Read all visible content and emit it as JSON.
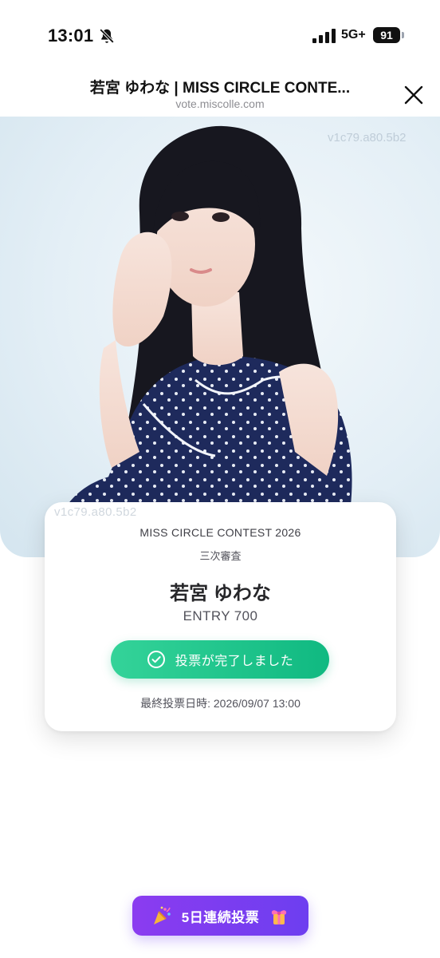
{
  "status_bar": {
    "time": "13:01",
    "network": "5G+",
    "battery": "91"
  },
  "header": {
    "title": "若宮 ゆわな | MISS CIRCLE CONTE...",
    "url": "vote.miscolle.com",
    "close_icon": "close-icon"
  },
  "watermark": "v1c79.a80.5b2",
  "card": {
    "contest": "MISS CIRCLE CONTEST 2026",
    "stage": "三次審査",
    "name": "若宮 ゆわな",
    "entry": "ENTRY 700",
    "vote_status": "投票が完了しました",
    "deadline": "最終投票日時: 2026/09/07 13:00"
  },
  "streak": {
    "label": "5日連続投票",
    "left_icon": "party-popper-icon",
    "right_icon": "ribbon-gift-icon"
  },
  "colors": {
    "vote_button": "#10b981",
    "streak_button": "#7c3aed"
  }
}
